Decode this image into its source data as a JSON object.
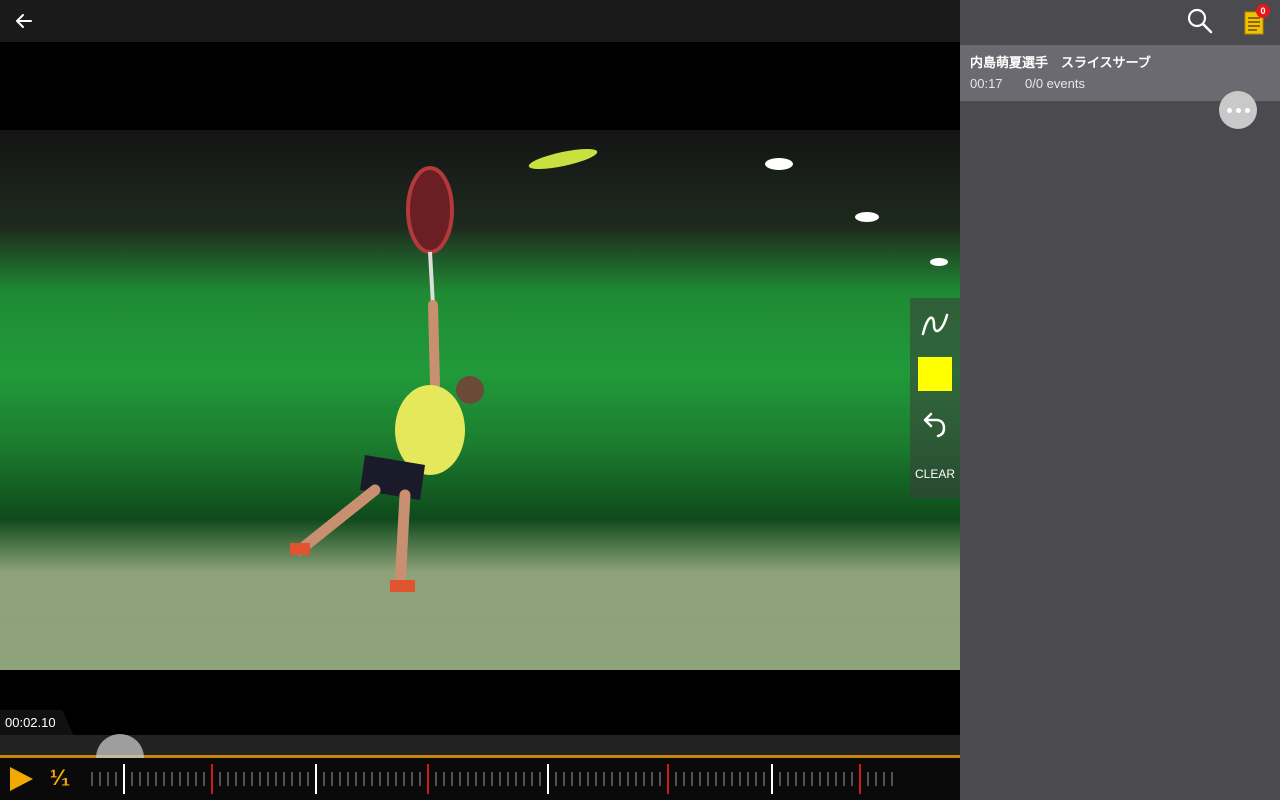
{
  "player": {
    "timecode": "00:02.10",
    "speed_label": "¹⁄₁",
    "progress": 0.125
  },
  "drawing_tools": {
    "pen_icon": "freehand-curve-icon",
    "color": "#ffff00",
    "undo_icon": "undo-arrow-icon",
    "clear_label": "CLEAR"
  },
  "sidebar": {
    "notification_count": "0",
    "clip": {
      "title": "内島萌夏選手　スライスサーブ",
      "duration": "00:17",
      "events": "0/0 events"
    }
  },
  "colors": {
    "accent": "#f2a900",
    "sidebar_bg": "#4a4a4f",
    "card_bg": "#6a6a70",
    "badge": "#e21a1a"
  }
}
